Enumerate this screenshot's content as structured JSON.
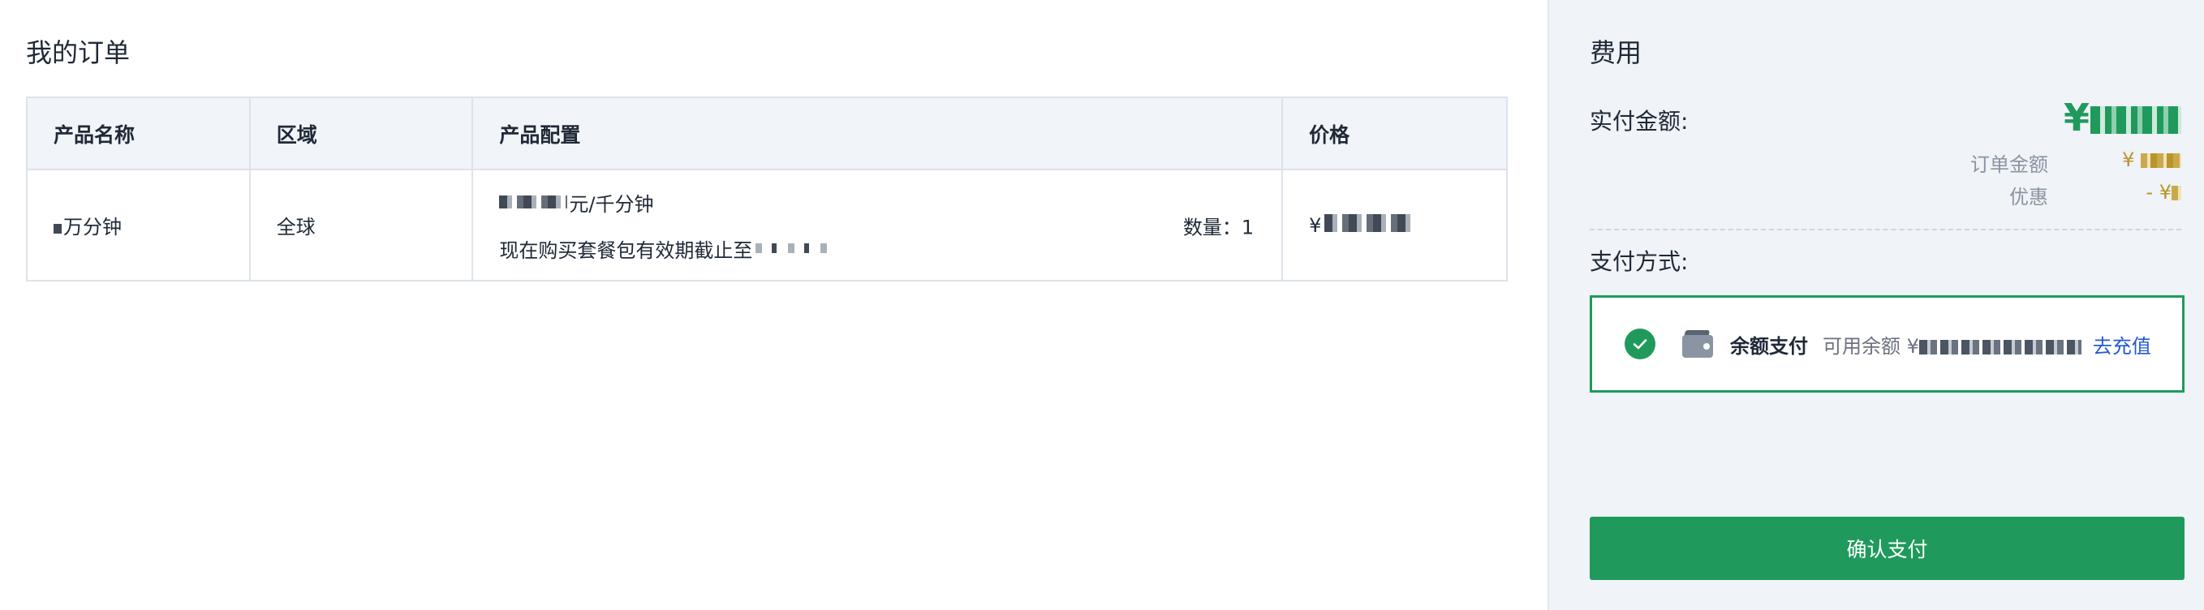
{
  "orders": {
    "title": "我的订单",
    "columns": [
      "产品名称",
      "区域",
      "产品配置",
      "价格"
    ],
    "rows": [
      {
        "name": "万分钟",
        "region": "全球",
        "config_line1": "元/千分钟",
        "config_line2": "现在购买套餐包有效期截止至",
        "quantity": "数量：1",
        "price": "¥"
      }
    ]
  },
  "cost": {
    "title": "费用",
    "paid_label": "实付金额:",
    "paid_prefix": "¥",
    "order_amount_label": "订单金额",
    "order_amount_prefix": "¥",
    "discount_label": "优惠",
    "discount_prefix": "- ¥",
    "pay_method_label": "支付方式:",
    "pay_option": {
      "name": "余额支付",
      "available_label": "可用余额 ¥",
      "topup_label": "去充值"
    },
    "confirm_label": "确认支付"
  },
  "colors": {
    "accent_green": "#1f9a5c",
    "link_blue": "#2458d4",
    "gold": "#b8952b"
  },
  "icons": [
    "check-circle-icon",
    "wallet-icon"
  ]
}
